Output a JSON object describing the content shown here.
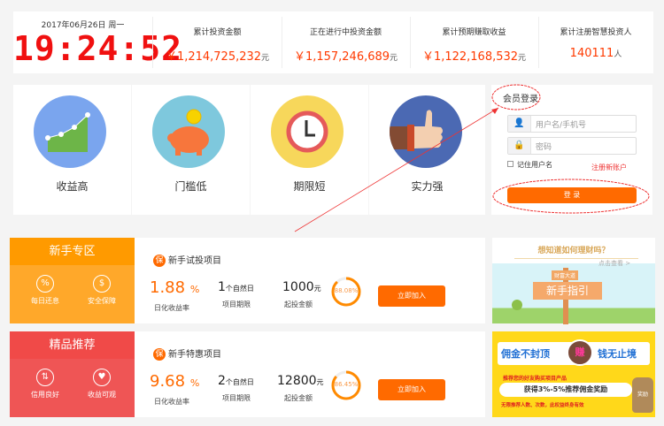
{
  "clock": {
    "date": "2017年06月26日 周一",
    "time": "19:24:52"
  },
  "stats": [
    {
      "label": "累计投资金额",
      "value": "￥1,214,725,232",
      "unit": "元"
    },
    {
      "label": "正在进行中投资金额",
      "value": "￥1,157,246,689",
      "unit": "元"
    },
    {
      "label": "累计预期赚取收益",
      "value": "￥1,122,168,532",
      "unit": "元"
    },
    {
      "label": "累计注册智慧投资人",
      "value": "140111",
      "unit": "人"
    }
  ],
  "features": [
    {
      "label": "收益高",
      "icon": "chart-growth-icon",
      "color": "#7aa5ee"
    },
    {
      "label": "门槛低",
      "icon": "piggy-bank-icon",
      "color": "#7ec8dd"
    },
    {
      "label": "期限短",
      "icon": "clock-icon",
      "color": "#f7d75b"
    },
    {
      "label": "实力强",
      "icon": "thumbs-up-icon",
      "color": "#4b69b3"
    }
  ],
  "login": {
    "title": "会员登录",
    "username_placeholder": "用户名/手机号",
    "password_placeholder": "密码",
    "remember": "记住用户名",
    "register": "注册新账户",
    "submit": "登 录"
  },
  "products": [
    {
      "zone": "新手专区",
      "badges": [
        "每日还息",
        "安全保障"
      ],
      "badge_icons": [
        "%",
        "$"
      ],
      "badge": "保",
      "name": "新手试投项目",
      "rate": "1.88",
      "rate_unit": "%",
      "rate_label": "日化收益率",
      "term": "1",
      "term_unit": "个自然日",
      "term_label": "项目期限",
      "min": "1000",
      "min_unit": "元",
      "min_label": "起投金额",
      "progress": "88.08%",
      "progress_value": 88.08,
      "join": "立即加入",
      "color": "#ffa11a"
    },
    {
      "zone": "精品推荐",
      "badges": [
        "信用良好",
        "收益可观"
      ],
      "badge_icons": [
        "⇅",
        "♥"
      ],
      "badge": "保",
      "name": "新手特惠项目",
      "rate": "9.68",
      "rate_unit": "%",
      "rate_label": "日化收益率",
      "term": "2",
      "term_unit": "个自然日",
      "term_label": "项目期限",
      "min": "12800",
      "min_unit": "元",
      "min_label": "起投金额",
      "progress": "86.45%",
      "progress_value": 86.45,
      "join": "立即加入",
      "color": "#f05050"
    }
  ],
  "banners": [
    {
      "headline": "想知道如何理财吗？",
      "link": "点击查看 >",
      "sign_small": "财富大道",
      "sign": "新手指引"
    },
    {
      "headline_left": "佣金不封顶",
      "headline_mid": "赚",
      "headline_right": "钱无止境",
      "line1": "推荐您的好友购买项目产品",
      "line2": "获得3%-5%推荐佣金奖励",
      "line3": "无限推荐人数、次数，此权益终身有效",
      "bag": "奖励"
    }
  ]
}
